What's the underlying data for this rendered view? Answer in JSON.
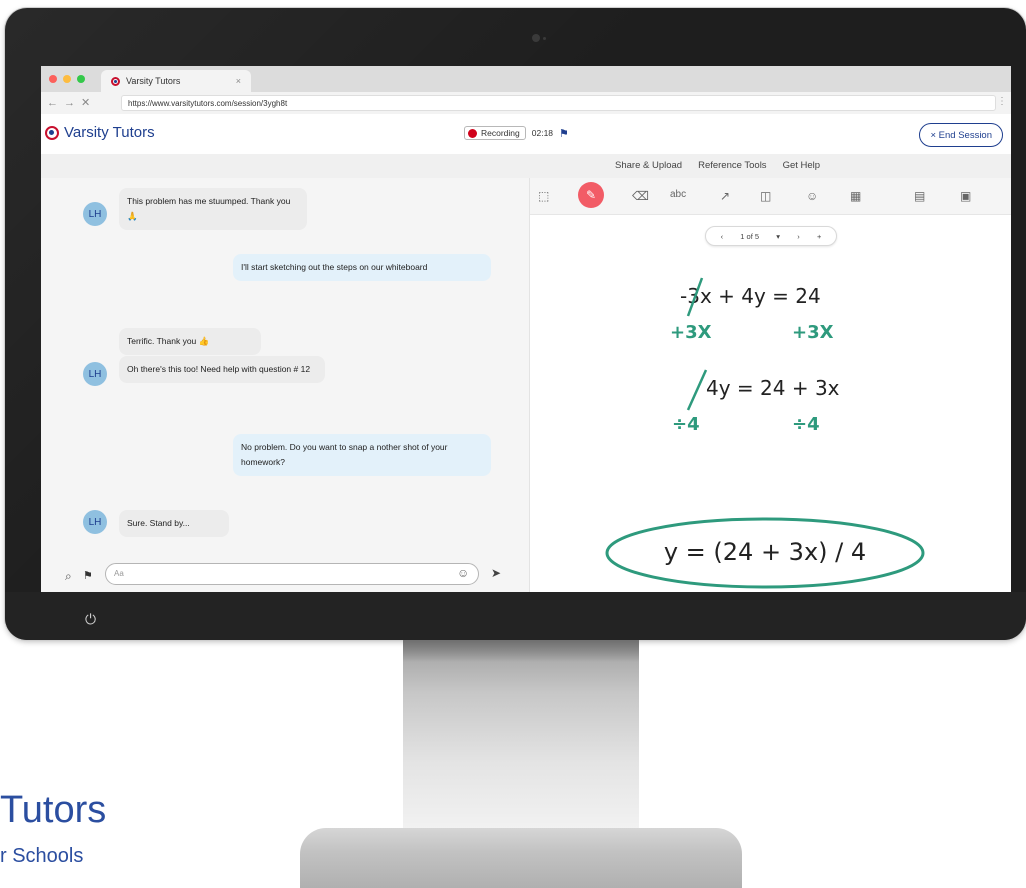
{
  "browser": {
    "tab_title": "Varsity Tutors",
    "tab_close": "×",
    "url": "https://www.varsitytutors.com/session/3ygh8t"
  },
  "header": {
    "brand": "Varsity Tutors",
    "recording_label": "Recording",
    "timer": "02:18",
    "end_session": "× End Session"
  },
  "menu": [
    "Share & Upload",
    "Reference Tools",
    "Get Help"
  ],
  "chat": {
    "avatar_initials": "LH",
    "messages": [
      {
        "from": "student",
        "text": "This problem has me stuumped. Thank you 🙏"
      },
      {
        "from": "tutor",
        "text": "I'll start sketching out the steps on our whiteboard"
      },
      {
        "from": "student",
        "text": "Terrific. Thank you 👍"
      },
      {
        "from": "student",
        "text": "Oh there's this too! Need help with question # 12"
      },
      {
        "from": "tutor",
        "text": "No problem. Do you want to snap a nother shot of your homework?"
      },
      {
        "from": "student",
        "text": "Sure. Stand by..."
      }
    ],
    "input_placeholder": "Aa"
  },
  "whiteboard": {
    "pager": {
      "label": "1 of 5",
      "caret": "▾",
      "next": "›",
      "prev": "‹",
      "add": "+"
    },
    "equations": {
      "line1": "-3x + 4y = 24",
      "line1_left_note": "+3X",
      "line1_right_note": "+3X",
      "line2": "4y = 24 + 3x",
      "line2_left_note": "÷4",
      "line2_right_note": "÷4",
      "result": "y = (24 + 3x) / 4"
    },
    "more": "···"
  },
  "accent_colors": {
    "brand_blue": "#1f3f8f",
    "brand_red": "#c8102e",
    "recording_red": "#d0021b",
    "pen_active": "#f25c66",
    "handwriting_green": "#2e9a7d"
  },
  "watermark": {
    "title": "Tutors",
    "subtitle": "r Schools"
  }
}
